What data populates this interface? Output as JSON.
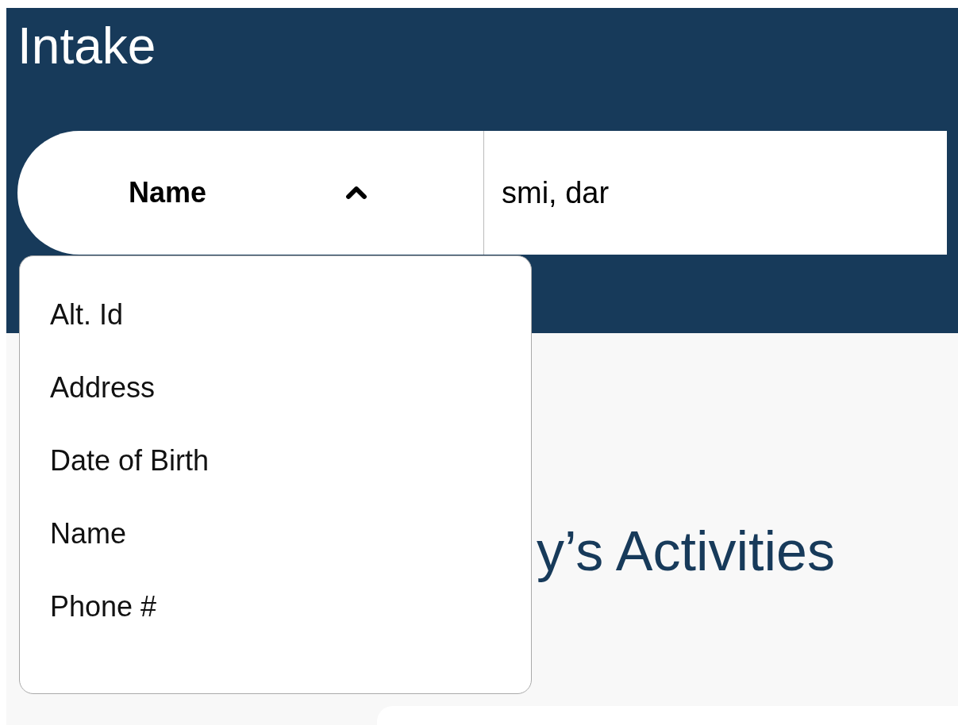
{
  "header": {
    "title": "Intake"
  },
  "search": {
    "field_selector": {
      "label": "Name",
      "expanded": true
    },
    "value": "smi, dar"
  },
  "dropdown": {
    "options": [
      {
        "label": "Alt. Id",
        "selected": false
      },
      {
        "label": "Address",
        "selected": false
      },
      {
        "label": "Date of Birth",
        "selected": false
      },
      {
        "label": "Name",
        "selected": false
      },
      {
        "label": "Phone #",
        "selected": false
      }
    ]
  },
  "section": {
    "heading": "y’s Activities"
  }
}
